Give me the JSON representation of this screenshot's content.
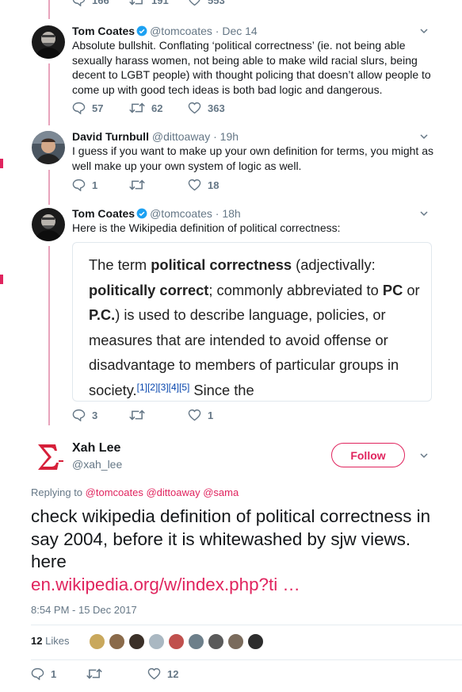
{
  "top_actions": {
    "replies": "166",
    "retweets": "191",
    "likes": "553"
  },
  "tweets": [
    {
      "name": "Tom Coates",
      "handle": "@tomcoates",
      "time": "· Dec 14",
      "text": "Absolute bullshit. Conflating ‘political correctness’ (ie. not being able sexually harass women, not being able to make wild racial slurs, being decent to LGBT people) with thought policing that doesn’t allow people to come up with good tech ideas is both bad logic and dangerous.",
      "replies": "57",
      "retweets": "62",
      "likes": "363"
    },
    {
      "name": "David Turnbull",
      "handle": "@dittoaway",
      "time": "· 19h",
      "text": "I guess if you want to make up your own definition for terms, you might as well make up your own system of logic as well.",
      "replies": "1",
      "retweets": "",
      "likes": "18"
    },
    {
      "name": "Tom Coates",
      "handle": "@tomcoates",
      "time": "· 18h",
      "text": "Here is the Wikipedia definition of political correctness:",
      "replies": "3",
      "retweets": "",
      "likes": "1"
    }
  ],
  "wiki_card": {
    "t1": "The term ",
    "b1": "political correctness",
    "t2": " (adjectivally: ",
    "b2": "politically correct",
    "t3": "; commonly abbreviated to ",
    "b3": "PC",
    "t4": " or ",
    "b4": "P.C.",
    "t5": ") is used to describe language, policies, or measures that are intended to avoid offense or disadvantage to members of particular groups in society.",
    "refs": "[1][2][3][4][5]",
    "t6": " Since the"
  },
  "main_tweet": {
    "name": "Xah Lee",
    "handle": "@xah_lee",
    "follow_label": "Follow",
    "replying_label": "Replying to ",
    "mentions": [
      "@tomcoates",
      "@dittoaway",
      "@sama"
    ],
    "text": "check wikipedia definition of political correctness in say 2004, before it is whitewashed by sjw views. here",
    "link": "en.wikipedia.org/w/index.php?ti …",
    "timestamp": "8:54 PM - 15 Dec 2017",
    "likes_count": "12",
    "likes_label": "Likes",
    "replies": "1",
    "retweets": "",
    "likes": "12"
  },
  "colors": {
    "accent": "#e0245e",
    "verified": "#1da1f2",
    "muted": "#657786",
    "thread": "#e8a4bc"
  }
}
